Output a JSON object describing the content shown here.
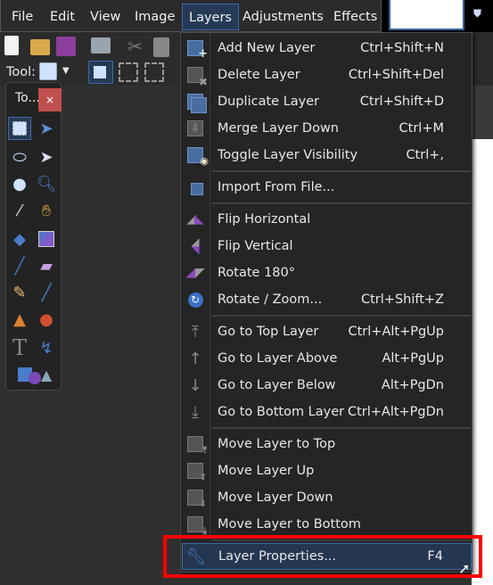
{
  "menubar": {
    "items": [
      "File",
      "Edit",
      "View",
      "Image",
      "Layers",
      "Adjustments",
      "Effects"
    ],
    "active": "Layers"
  },
  "toolbar": {
    "tool_label": "Tool:"
  },
  "toolbox": {
    "title": "To...",
    "close": "×"
  },
  "layers_menu": {
    "items": [
      {
        "label": "Add New Layer",
        "shortcut": "Ctrl+Shift+N",
        "icon": "add-layer-icon"
      },
      {
        "label": "Delete Layer",
        "shortcut": "Ctrl+Shift+Del",
        "icon": "delete-layer-icon"
      },
      {
        "label": "Duplicate Layer",
        "shortcut": "Ctrl+Shift+D",
        "icon": "duplicate-layer-icon"
      },
      {
        "label": "Merge Layer Down",
        "shortcut": "Ctrl+M",
        "icon": "merge-layer-down-icon"
      },
      {
        "label": "Toggle Layer Visibility",
        "shortcut": "Ctrl+,",
        "icon": "eye-icon"
      },
      {
        "label": "Import From File...",
        "shortcut": "",
        "icon": "import-file-icon"
      },
      {
        "label": "Flip Horizontal",
        "shortcut": "",
        "icon": "flip-horizontal-icon"
      },
      {
        "label": "Flip Vertical",
        "shortcut": "",
        "icon": "flip-vertical-icon"
      },
      {
        "label": "Rotate 180°",
        "shortcut": "",
        "icon": "rotate-180-icon"
      },
      {
        "label": "Rotate / Zoom...",
        "shortcut": "Ctrl+Shift+Z",
        "icon": "rotate-zoom-icon"
      },
      {
        "label": "Go to Top Layer",
        "shortcut": "Ctrl+Alt+PgUp",
        "icon": "arrow-top-icon"
      },
      {
        "label": "Go to Layer Above",
        "shortcut": "Alt+PgUp",
        "icon": "arrow-up-icon"
      },
      {
        "label": "Go to Layer Below",
        "shortcut": "Alt+PgDn",
        "icon": "arrow-down-icon"
      },
      {
        "label": "Go to Bottom Layer",
        "shortcut": "Ctrl+Alt+PgDn",
        "icon": "arrow-bottom-icon"
      },
      {
        "label": "Move Layer to Top",
        "shortcut": "",
        "icon": "move-layer-top-icon"
      },
      {
        "label": "Move Layer Up",
        "shortcut": "",
        "icon": "move-layer-up-icon"
      },
      {
        "label": "Move Layer Down",
        "shortcut": "",
        "icon": "move-layer-down-icon"
      },
      {
        "label": "Move Layer to Bottom",
        "shortcut": "",
        "icon": "move-layer-bottom-icon"
      },
      {
        "label": "Layer Properties...",
        "shortcut": "F4",
        "icon": "wrench-icon",
        "highlighted": true
      }
    ]
  },
  "colors": {
    "accent": "#3c6aa8",
    "highlight_box": "#ff0000",
    "menu_bg": "#252525"
  }
}
